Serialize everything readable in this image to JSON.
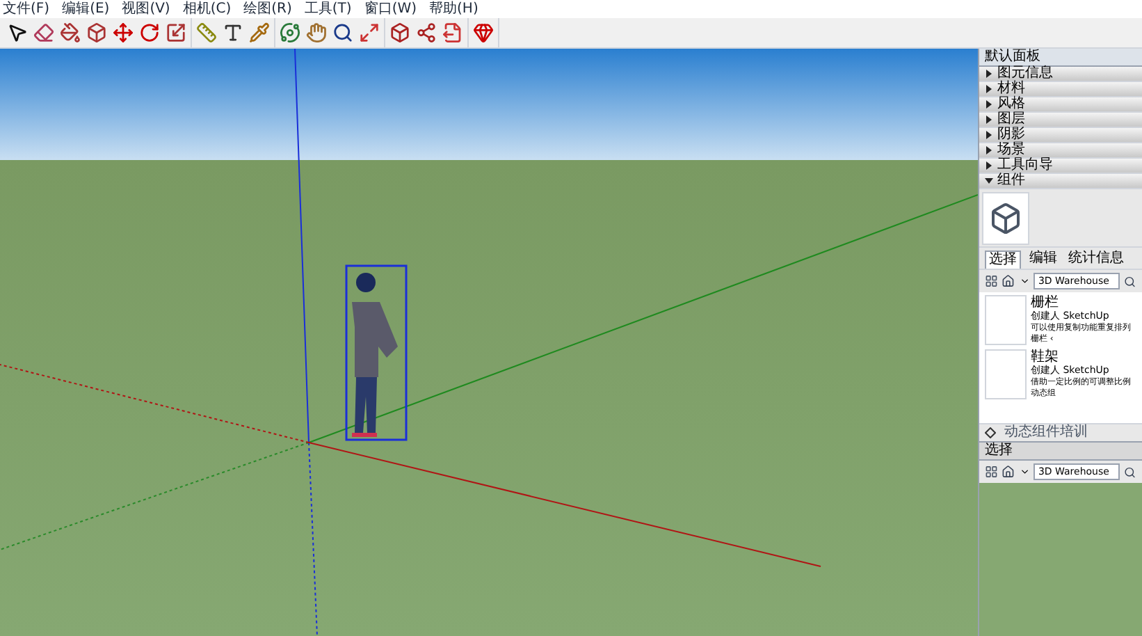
{
  "menu": [
    "文件(F)",
    "编辑(E)",
    "视图(V)",
    "相机(C)",
    "绘图(R)",
    "工具(T)",
    "窗口(W)",
    "帮助(H)"
  ],
  "tray": {
    "title": "默认面板",
    "sections": [
      {
        "label": "图元信息",
        "expanded": false
      },
      {
        "label": "材料",
        "expanded": false
      },
      {
        "label": "风格",
        "expanded": false
      },
      {
        "label": "图层",
        "expanded": false
      },
      {
        "label": "阴影",
        "expanded": false
      },
      {
        "label": "场景",
        "expanded": false
      },
      {
        "label": "工具向导",
        "expanded": false
      },
      {
        "label": "组件",
        "expanded": true
      }
    ],
    "tabs": [
      {
        "label": "选择",
        "selected": true
      },
      {
        "label": "编辑",
        "selected": false
      },
      {
        "label": "统计信息",
        "selected": false
      }
    ],
    "search": {
      "value": "3D Warehouse"
    },
    "items": [
      {
        "name": "栅栏",
        "author": "创建人 SketchUp",
        "description": "可以使用复制功能重复排列栅栏 ‹"
      },
      {
        "name": "鞋架",
        "author": "创建人 SketchUp",
        "description": "借助一定比例的可调整比例动态组"
      }
    ],
    "footer": "动态组件培训",
    "second_header": "选择",
    "second_search": {
      "value": "3D Warehouse"
    }
  }
}
